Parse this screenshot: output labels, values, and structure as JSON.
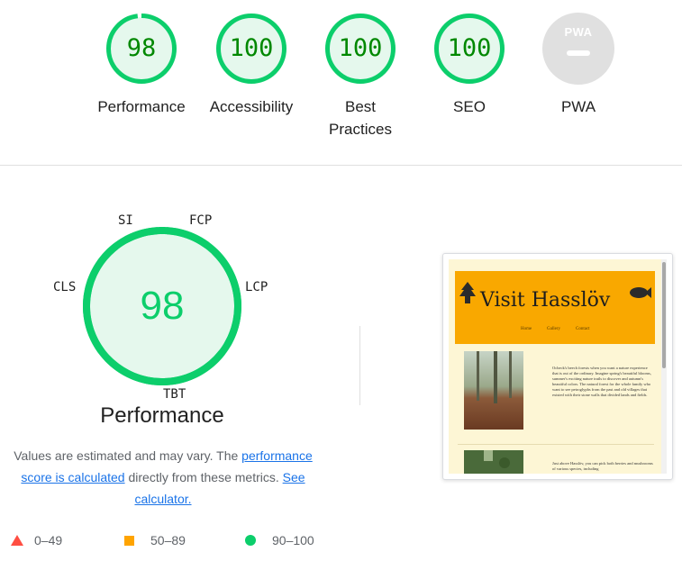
{
  "categories": [
    {
      "id": "performance",
      "score": "98",
      "label": "Performance"
    },
    {
      "id": "accessibility",
      "score": "100",
      "label": "Accessibility"
    },
    {
      "id": "best-practices",
      "score": "100",
      "label": "Best Practices"
    },
    {
      "id": "seo",
      "score": "100",
      "label": "SEO"
    },
    {
      "id": "pwa",
      "badge_text": "PWA",
      "label": "PWA"
    }
  ],
  "main_gauge": {
    "score": "98",
    "title": "Performance",
    "metrics": [
      "SI",
      "FCP",
      "LCP",
      "TBT",
      "CLS"
    ]
  },
  "description": {
    "pre": "Values are estimated and may vary. The ",
    "link1": "performance score is calculated",
    "mid": " directly from these metrics. ",
    "link2": "See calculator."
  },
  "legend": {
    "fail": "0–49",
    "average": "50–89",
    "pass": "90–100"
  },
  "screenshot": {
    "site_title": "Visit Hasslöv",
    "nav": [
      "Home",
      "Gallery",
      "Contact"
    ],
    "paragraph1": "Ocbeck's beech forests when you want a nature experience that is out of the ordinary. Imagine spring's beautiful blooms, summer's exciting nature trails to discover and autumn's beautiful colors. The natural forest for the whole family who want to see petroglyphs from the past and old villages that existed with their stone walls that divided lands and fields.",
    "paragraph2": "Just above Hasslöv, you can pick both berries and mushrooms of various species, including"
  },
  "colors": {
    "pass": "#0cce6b",
    "pass_text": "#008800",
    "pass_fill": "#e5f8ed",
    "average": "#ffa400",
    "fail": "#ff4e42",
    "na": "#e0e0e0",
    "link": "#1a73e8"
  }
}
